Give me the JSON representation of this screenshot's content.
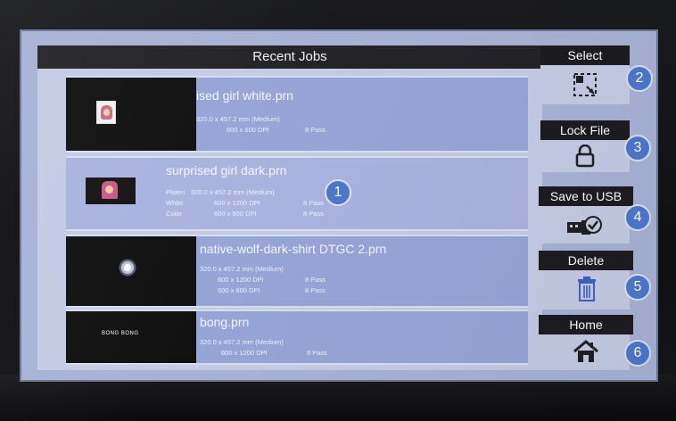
{
  "list": {
    "title": "Recent Jobs",
    "jobs": [
      {
        "name": "ised girl white.prn",
        "lines": [
          {
            "a": "320.0 x 457.2 mm (Medium)",
            "b": ""
          },
          {
            "a": "600 x  600 DPI",
            "b": "8 Pass"
          }
        ]
      },
      {
        "name": "surprised girl dark.prn",
        "lines": [
          {
            "label": "Platen",
            "a": "320.0 x 457.2 mm (Medium)",
            "b": ""
          },
          {
            "label": "White",
            "a": "600 x 1200 DPI",
            "b": "8 Pass"
          },
          {
            "label": "Color",
            "a": "600 x  600 DPI",
            "b": "8 Pass"
          }
        ]
      },
      {
        "name": "native-wolf-dark-shirt DTGC 2.prn",
        "lines": [
          {
            "a": "320.0 x 457.2 mm (Medium)",
            "b": ""
          },
          {
            "a": "600 x 1200 DPI",
            "b": "8 Pass"
          },
          {
            "a": "600 x  600 DPI",
            "b": "8 Pass"
          }
        ]
      },
      {
        "name": "bong.prn",
        "lines": [
          {
            "a": "320.0 x 457.2 mm (Medium)",
            "b": ""
          },
          {
            "a": "600 x 1200 DPI",
            "b": "8 Pass"
          }
        ]
      }
    ],
    "thumb_text": "BONG BONG"
  },
  "sidebar": {
    "select": "Select",
    "lock": "Lock File",
    "usb": "Save to USB",
    "delete": "Delete",
    "home": "Home"
  },
  "callouts": [
    "1",
    "2",
    "3",
    "4",
    "5",
    "6"
  ],
  "icons": {
    "select": "selection-icon",
    "lock": "lock-icon",
    "usb": "usb-save-icon",
    "delete": "trash-icon",
    "home": "home-icon"
  },
  "colors": {
    "screen_bg": "#a8b2d6",
    "row_bg": "#97a4d6",
    "header_bg": "#232328",
    "callout": "#4f78cc",
    "delete_icon": "#3f63c4"
  }
}
